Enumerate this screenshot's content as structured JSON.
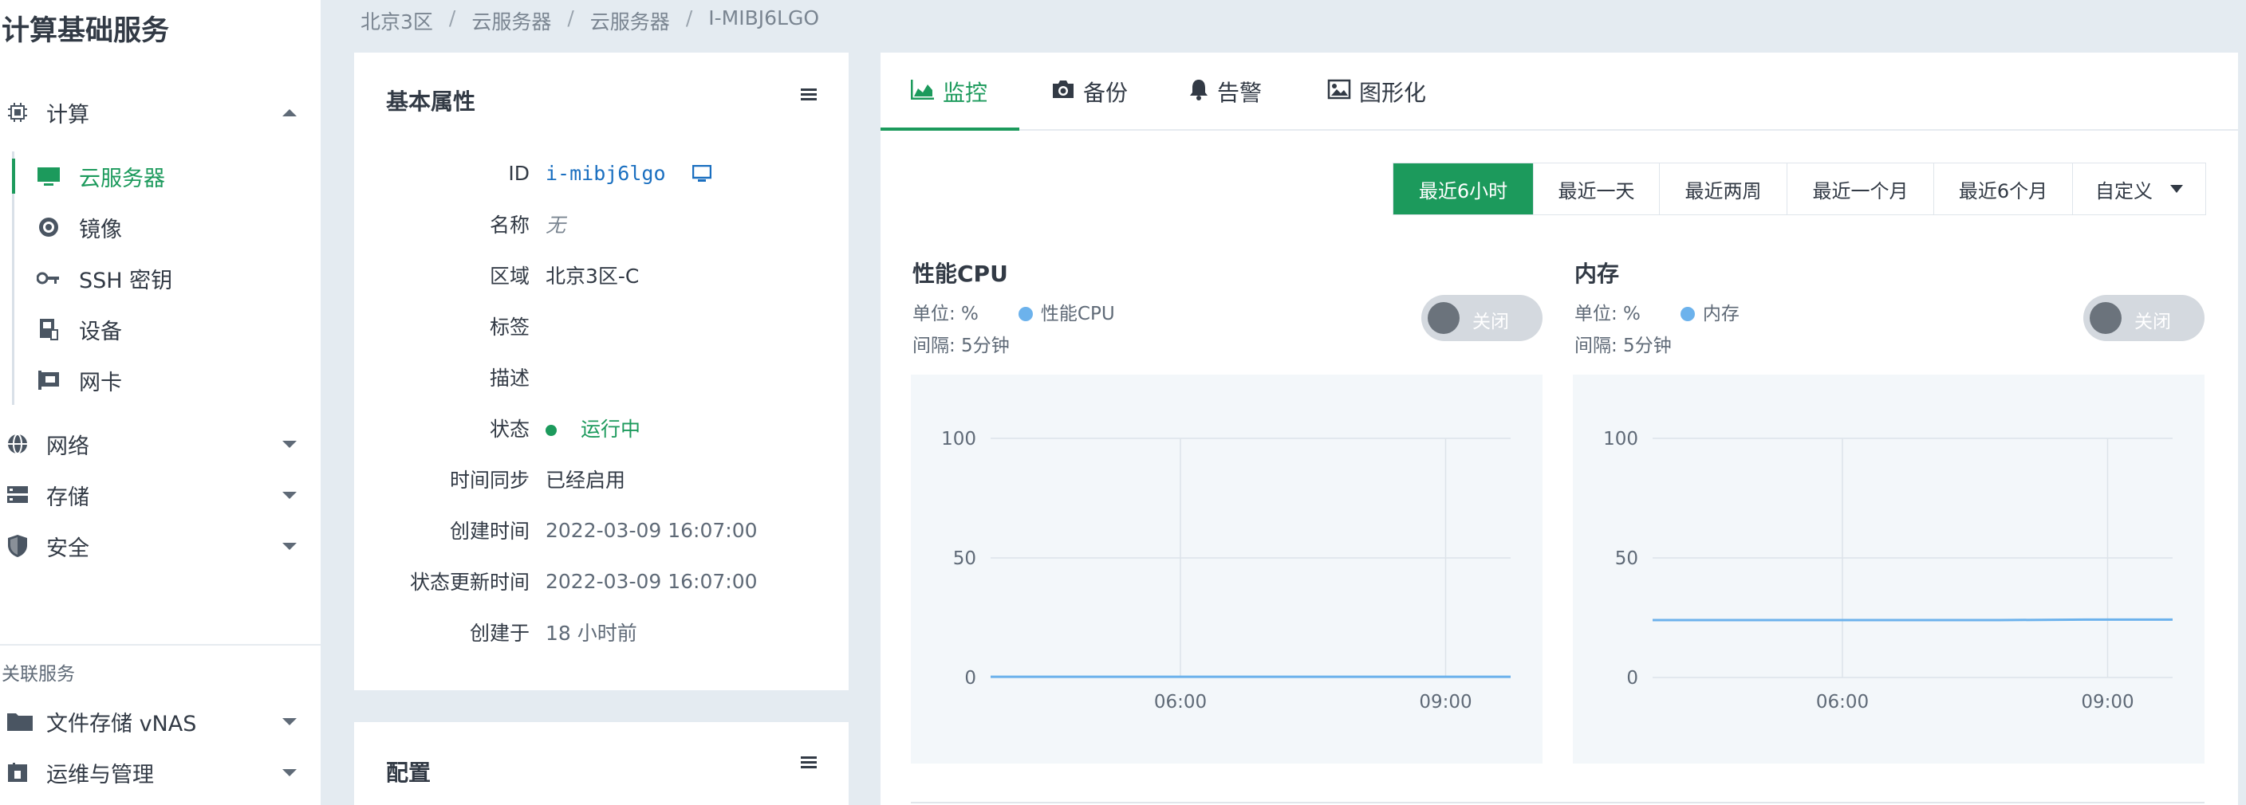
{
  "sidebar": {
    "title": "计算基础服务",
    "compute": {
      "label": "计算",
      "icon": "chip-icon"
    },
    "sub_items": [
      {
        "label": "云服务器",
        "icon": "monitor-icon",
        "active": true
      },
      {
        "label": "镜像",
        "icon": "disc-icon"
      },
      {
        "label": "SSH 密钥",
        "icon": "key-icon"
      },
      {
        "label": "设备",
        "icon": "device-icon"
      },
      {
        "label": "网卡",
        "icon": "nic-icon"
      }
    ],
    "groups": [
      {
        "label": "网络",
        "icon": "globe-icon"
      },
      {
        "label": "存储",
        "icon": "storage-icon"
      },
      {
        "label": "安全",
        "icon": "shield-icon"
      }
    ],
    "related_title": "关联服务",
    "related": [
      {
        "label": "文件存储 vNAS",
        "icon": "folder-icon"
      },
      {
        "label": "运维与管理",
        "icon": "ops-icon"
      }
    ]
  },
  "breadcrumb": [
    "北京3区",
    "云服务器",
    "云服务器",
    "I-MIBJ6LGO"
  ],
  "basic": {
    "title": "基本属性",
    "rows": [
      {
        "key": "ID",
        "value": "i-mibj6lgo"
      },
      {
        "key": "名称",
        "value": "无"
      },
      {
        "key": "区域",
        "value": "北京3区-C"
      },
      {
        "key": "标签",
        "value": ""
      },
      {
        "key": "描述",
        "value": ""
      },
      {
        "key": "状态",
        "value": "运行中"
      },
      {
        "key": "时间同步",
        "value": "已经启用"
      },
      {
        "key": "创建时间",
        "value": "2022-03-09 16:07:00"
      },
      {
        "key": "状态更新时间",
        "value": "2022-03-09 16:07:00"
      },
      {
        "key": "创建于",
        "value": "18 小时前"
      }
    ]
  },
  "config": {
    "title": "配置"
  },
  "tabs": [
    {
      "label": "监控",
      "icon": "area-chart-icon"
    },
    {
      "label": "备份",
      "icon": "camera-icon"
    },
    {
      "label": "告警",
      "icon": "bell-icon"
    },
    {
      "label": "图形化",
      "icon": "image-icon"
    }
  ],
  "ranges": [
    "最近6小时",
    "最近一天",
    "最近两周",
    "最近一个月",
    "最近6个月",
    "自定义"
  ],
  "colors": {
    "accent": "#1c9a5c",
    "series": "#6cb2ec",
    "link": "#1a6fc0"
  },
  "monitors": [
    {
      "title": "性能CPU",
      "unit": "单位: %",
      "legend": "性能CPU",
      "interval": "间隔: 5分钟",
      "toggle": "关闭"
    },
    {
      "title": "内存",
      "unit": "单位: %",
      "legend": "内存",
      "interval": "间隔: 5分钟",
      "toggle": "关闭"
    }
  ],
  "chart_data": [
    {
      "type": "line",
      "title": "性能CPU",
      "ylim": [
        0,
        100
      ],
      "yticks": [
        "100",
        "50",
        "0"
      ],
      "xticks": [
        "06:00",
        "09:00"
      ],
      "grid": true,
      "series": [
        {
          "name": "性能CPU",
          "values": [
            0.3,
            0.3,
            0.3,
            0.3,
            0.3,
            0.3,
            0.3
          ]
        }
      ]
    },
    {
      "type": "line",
      "title": "内存",
      "ylim": [
        0,
        100
      ],
      "yticks": [
        "100",
        "50",
        "0"
      ],
      "xticks": [
        "06:00",
        "09:00"
      ],
      "grid": true,
      "series": [
        {
          "name": "内存",
          "values": [
            24,
            24,
            24,
            24,
            24,
            24.2,
            24.2
          ]
        }
      ]
    }
  ]
}
